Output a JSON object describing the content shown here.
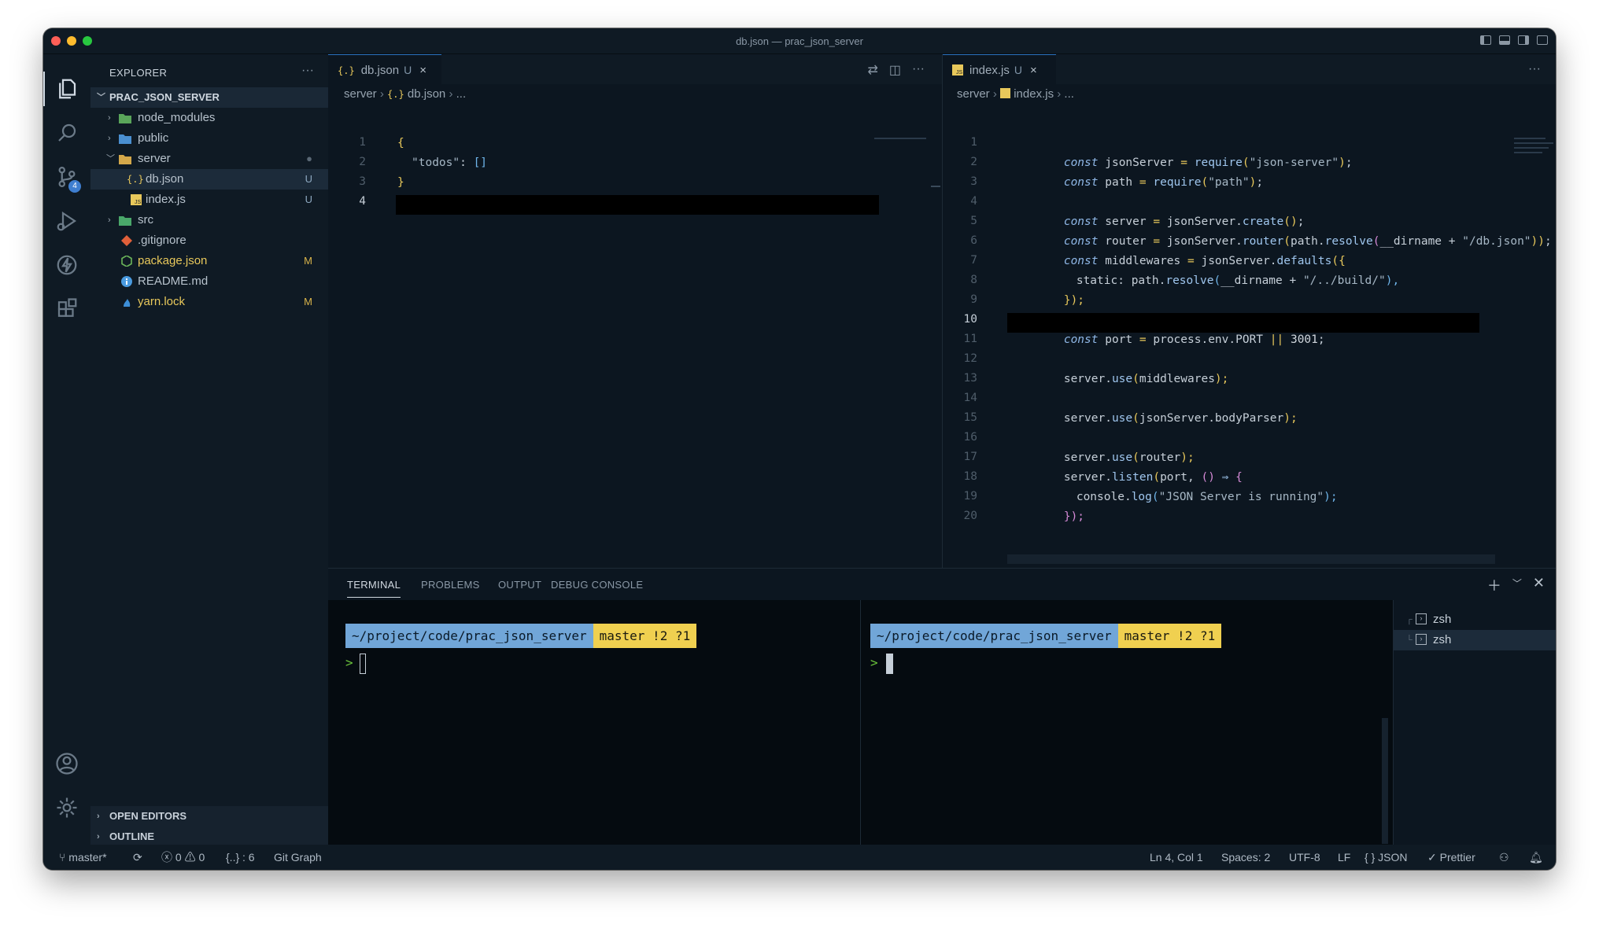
{
  "window": {
    "title": "db.json — prac_json_server"
  },
  "activity": {
    "source_control_badge": "4"
  },
  "sidebar": {
    "header": "EXPLORER",
    "more": "···",
    "project": "PRAC_JSON_SERVER",
    "items": [
      {
        "label": "node_modules",
        "status": ""
      },
      {
        "label": "public",
        "status": ""
      },
      {
        "label": "server",
        "status": "●"
      },
      {
        "label": "db.json",
        "status": "U"
      },
      {
        "label": "index.js",
        "status": "U"
      },
      {
        "label": "src",
        "status": ""
      },
      {
        "label": ".gitignore",
        "status": ""
      },
      {
        "label": "package.json",
        "status": "M"
      },
      {
        "label": "README.md",
        "status": ""
      },
      {
        "label": "yarn.lock",
        "status": "M"
      }
    ],
    "sections": {
      "open_editors": "OPEN EDITORS",
      "outline": "OUTLINE"
    }
  },
  "left_editor": {
    "tab": {
      "label": "db.json",
      "status": "U",
      "close": "×"
    },
    "breadcrumb": {
      "folder": "server",
      "file": "db.json",
      "rest": "..."
    },
    "line_numbers": [
      "1",
      "2",
      "3",
      "4"
    ],
    "code": {
      "l1": "{",
      "l2_key": "\"todos\"",
      "l2_colon": ": ",
      "l2_val": "[]",
      "l3": "}"
    }
  },
  "right_editor": {
    "tab": {
      "label": "index.js",
      "status": "U",
      "close": "×"
    },
    "breadcrumb": {
      "folder": "server",
      "file": "index.js",
      "rest": "..."
    },
    "line_numbers": [
      "1",
      "2",
      "3",
      "4",
      "5",
      "6",
      "7",
      "8",
      "9",
      "10",
      "11",
      "12",
      "13",
      "14",
      "15",
      "16",
      "17",
      "18",
      "19",
      "20"
    ],
    "code": {
      "l1": [
        "const",
        " jsonServer ",
        "=",
        " require",
        "(",
        "\"json-server\"",
        ")",
        ";"
      ],
      "l2": [
        "const",
        " path ",
        "=",
        " require",
        "(",
        "\"path\"",
        ")",
        ";"
      ],
      "l4": [
        "const",
        " server ",
        "=",
        " jsonServer.",
        "create",
        "(",
        ")",
        ";"
      ],
      "l5": [
        "const",
        " router ",
        "=",
        " jsonServer.",
        "router",
        "(",
        "path.",
        "resolve",
        "(",
        "__dirname + ",
        "\"/db.json\"",
        "))",
        ";"
      ],
      "l6": [
        "const",
        " middlewares ",
        "=",
        " jsonServer.",
        "defaults",
        "({"
      ],
      "l7": [
        "static: ",
        "path.",
        "resolve",
        "(",
        "__dirname + ",
        "\"/../build/\"",
        "),"
      ],
      "l8": [
        "});"
      ],
      "l10": [
        "const",
        " port ",
        "=",
        " process.env.PORT ",
        "||",
        " 3001",
        ";"
      ],
      "l12": [
        "server.",
        "use",
        "(",
        "middlewares",
        ");"
      ],
      "l14": [
        "server.",
        "use",
        "(",
        "jsonServer.bodyParser",
        ");"
      ],
      "l16": [
        "server.",
        "use",
        "(",
        "router",
        ");"
      ],
      "l17": [
        "server.",
        "listen",
        "(",
        "port, ",
        "()",
        " ⇒ ",
        "{"
      ],
      "l18": [
        "console.",
        "log",
        "(",
        "\"JSON Server is running\"",
        ");"
      ],
      "l19": [
        "});"
      ]
    }
  },
  "panel": {
    "tabs": [
      "TERMINAL",
      "PROBLEMS",
      "OUTPUT",
      "DEBUG CONSOLE"
    ],
    "terminals": [
      {
        "path": "~/project/code/prac_json_server",
        "branch": "master !2 ?1",
        "caret": ">"
      },
      {
        "path": "~/project/code/prac_json_server",
        "branch": "master !2 ?1",
        "caret": ">"
      }
    ],
    "shells": [
      "zsh",
      "zsh"
    ]
  },
  "statusbar": {
    "branch": "master*",
    "errors": "0",
    "warnings": "0",
    "json_items": "{..} : 6",
    "git_graph": "Git Graph",
    "cursor": "Ln 4, Col 1",
    "spaces": "Spaces: 2",
    "encoding": "UTF-8",
    "eol": "LF",
    "language": "{ } JSON",
    "prettier": "✓ Prettier"
  }
}
